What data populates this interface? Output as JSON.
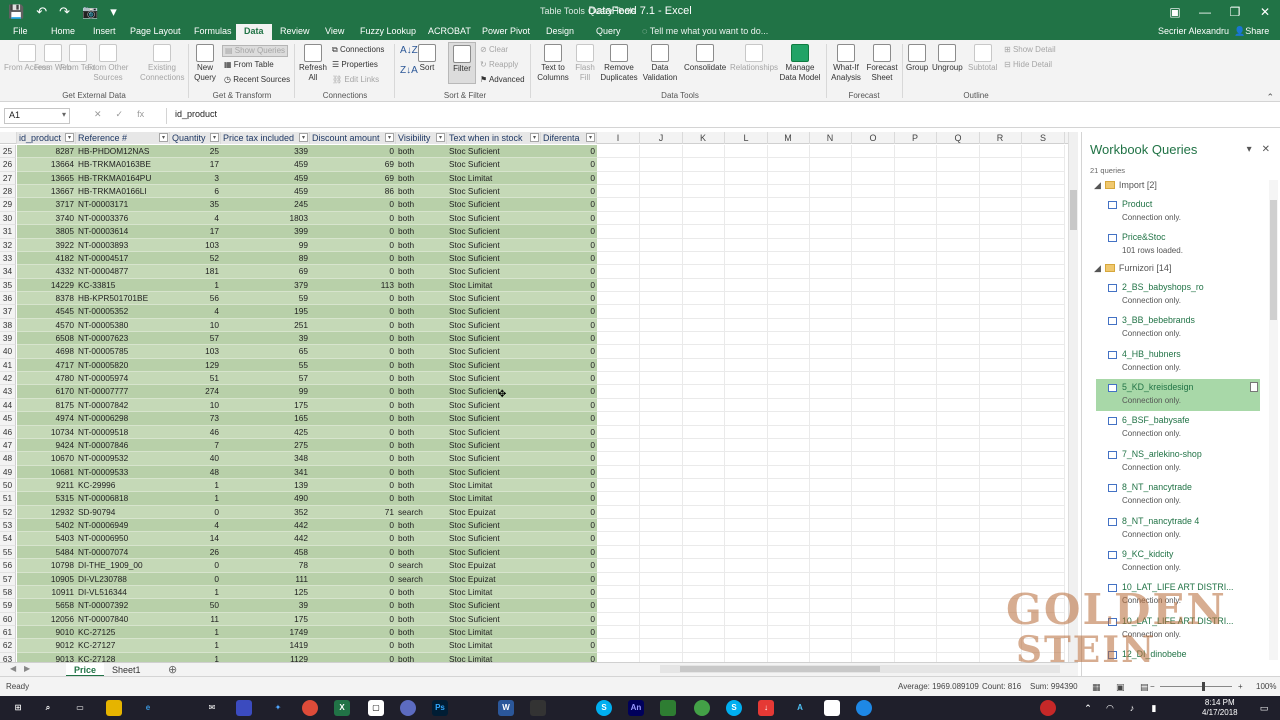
{
  "window": {
    "title": "DataFeed 7.1 - Excel",
    "context_tabs": [
      "Table Tools",
      "Query Tools"
    ],
    "controls": [
      "▣",
      "—",
      "❐",
      "✕"
    ]
  },
  "qat": [
    "💾",
    "↶",
    "↷",
    "📷",
    "▾"
  ],
  "tabs": [
    "File",
    "Home",
    "Insert",
    "Page Layout",
    "Formulas",
    "Data",
    "Review",
    "View",
    "Fuzzy Lookup",
    "ACROBAT",
    "Power Pivot",
    "Design",
    "Query"
  ],
  "active_tab": "Data",
  "tell_me": "Tell me what you want to do...",
  "user": "Secrier Alexandru",
  "share": "Share",
  "ribbon": {
    "get_external": {
      "label": "Get External Data",
      "buttons": [
        "From Access",
        "From Web",
        "From Text",
        "From Other Sources",
        "Existing Connections"
      ]
    },
    "get_transform": {
      "label": "Get & Transform",
      "new_query": "New Query",
      "show_queries": "Show Queries",
      "from_table": "From Table",
      "recent_sources": "Recent Sources"
    },
    "connections": {
      "label": "Connections",
      "refresh": "Refresh All",
      "connections": "Connections",
      "properties": "Properties",
      "edit_links": "Edit Links"
    },
    "sort_filter": {
      "label": "Sort & Filter",
      "sort": "Sort",
      "filter": "Filter",
      "clear": "Clear",
      "reapply": "Reapply",
      "advanced": "Advanced"
    },
    "data_tools": {
      "label": "Data Tools",
      "buttons": [
        "Text to Columns",
        "Flash Fill",
        "Remove Duplicates",
        "Data Validation",
        "Consolidate",
        "Relationships",
        "Manage Data Model"
      ]
    },
    "forecast": {
      "label": "Forecast",
      "buttons": [
        "What-If Analysis",
        "Forecast Sheet"
      ]
    },
    "outline": {
      "label": "Outline",
      "buttons": [
        "Group",
        "Ungroup",
        "Subtotal"
      ],
      "show_detail": "Show Detail",
      "hide_detail": "Hide Detail"
    }
  },
  "formula_bar": {
    "name_box": "A1",
    "formula": "id_product",
    "fx": [
      "✕",
      "✓",
      "fx"
    ]
  },
  "columns": {
    "table": [
      "id_product",
      "Reference #",
      "Quantity",
      "Price tax included",
      "Discount amount",
      "Visibility",
      "Text when in stock",
      "Diferenta"
    ],
    "extra": [
      "I",
      "J",
      "K",
      "L",
      "M",
      "N",
      "O",
      "P",
      "Q",
      "R",
      "S"
    ]
  },
  "rows": [
    {
      "n": "25",
      "id": "8287",
      "ref": "HB-PHDOM12NAS",
      "qty": "25",
      "price": "339",
      "disc": "0",
      "vis": "both",
      "stock": "Stoc Suficient",
      "dif": "0"
    },
    {
      "n": "26",
      "id": "13664",
      "ref": "HB-TRKMA0163BE",
      "qty": "17",
      "price": "459",
      "disc": "69",
      "vis": "both",
      "stock": "Stoc Suficient",
      "dif": "0"
    },
    {
      "n": "27",
      "id": "13665",
      "ref": "HB-TRKMA0164PU",
      "qty": "3",
      "price": "459",
      "disc": "69",
      "vis": "both",
      "stock": "Stoc Limitat",
      "dif": "0"
    },
    {
      "n": "28",
      "id": "13667",
      "ref": "HB-TRKMA0166LI",
      "qty": "6",
      "price": "459",
      "disc": "86",
      "vis": "both",
      "stock": "Stoc Suficient",
      "dif": "0"
    },
    {
      "n": "29",
      "id": "3717",
      "ref": "NT-00003171",
      "qty": "35",
      "price": "245",
      "disc": "0",
      "vis": "both",
      "stock": "Stoc Suficient",
      "dif": "0"
    },
    {
      "n": "30",
      "id": "3740",
      "ref": "NT-00003376",
      "qty": "4",
      "price": "1803",
      "disc": "0",
      "vis": "both",
      "stock": "Stoc Suficient",
      "dif": "0"
    },
    {
      "n": "31",
      "id": "3805",
      "ref": "NT-00003614",
      "qty": "17",
      "price": "399",
      "disc": "0",
      "vis": "both",
      "stock": "Stoc Suficient",
      "dif": "0"
    },
    {
      "n": "32",
      "id": "3922",
      "ref": "NT-00003893",
      "qty": "103",
      "price": "99",
      "disc": "0",
      "vis": "both",
      "stock": "Stoc Suficient",
      "dif": "0"
    },
    {
      "n": "33",
      "id": "4182",
      "ref": "NT-00004517",
      "qty": "52",
      "price": "89",
      "disc": "0",
      "vis": "both",
      "stock": "Stoc Suficient",
      "dif": "0"
    },
    {
      "n": "34",
      "id": "4332",
      "ref": "NT-00004877",
      "qty": "181",
      "price": "69",
      "disc": "0",
      "vis": "both",
      "stock": "Stoc Suficient",
      "dif": "0"
    },
    {
      "n": "35",
      "id": "14229",
      "ref": "KC-33815",
      "qty": "1",
      "price": "379",
      "disc": "113",
      "vis": "both",
      "stock": "Stoc Limitat",
      "dif": "0"
    },
    {
      "n": "36",
      "id": "8378",
      "ref": "HB-KPR501701BE",
      "qty": "56",
      "price": "59",
      "disc": "0",
      "vis": "both",
      "stock": "Stoc Suficient",
      "dif": "0"
    },
    {
      "n": "37",
      "id": "4545",
      "ref": "NT-00005352",
      "qty": "4",
      "price": "195",
      "disc": "0",
      "vis": "both",
      "stock": "Stoc Suficient",
      "dif": "0"
    },
    {
      "n": "38",
      "id": "4570",
      "ref": "NT-00005380",
      "qty": "10",
      "price": "251",
      "disc": "0",
      "vis": "both",
      "stock": "Stoc Suficient",
      "dif": "0"
    },
    {
      "n": "39",
      "id": "6508",
      "ref": "NT-00007623",
      "qty": "57",
      "price": "39",
      "disc": "0",
      "vis": "both",
      "stock": "Stoc Suficient",
      "dif": "0"
    },
    {
      "n": "40",
      "id": "4698",
      "ref": "NT-00005785",
      "qty": "103",
      "price": "65",
      "disc": "0",
      "vis": "both",
      "stock": "Stoc Suficient",
      "dif": "0"
    },
    {
      "n": "41",
      "id": "4717",
      "ref": "NT-00005820",
      "qty": "129",
      "price": "55",
      "disc": "0",
      "vis": "both",
      "stock": "Stoc Suficient",
      "dif": "0"
    },
    {
      "n": "42",
      "id": "4780",
      "ref": "NT-00005974",
      "qty": "51",
      "price": "57",
      "disc": "0",
      "vis": "both",
      "stock": "Stoc Suficient",
      "dif": "0"
    },
    {
      "n": "43",
      "id": "6170",
      "ref": "NT-00007777",
      "qty": "274",
      "price": "99",
      "disc": "0",
      "vis": "both",
      "stock": "Stoc Suficient",
      "dif": "0"
    },
    {
      "n": "44",
      "id": "8175",
      "ref": "NT-00007842",
      "qty": "10",
      "price": "175",
      "disc": "0",
      "vis": "both",
      "stock": "Stoc Suficient",
      "dif": "0"
    },
    {
      "n": "45",
      "id": "4974",
      "ref": "NT-00006298",
      "qty": "73",
      "price": "165",
      "disc": "0",
      "vis": "both",
      "stock": "Stoc Suficient",
      "dif": "0"
    },
    {
      "n": "46",
      "id": "10734",
      "ref": "NT-00009518",
      "qty": "46",
      "price": "425",
      "disc": "0",
      "vis": "both",
      "stock": "Stoc Suficient",
      "dif": "0"
    },
    {
      "n": "47",
      "id": "9424",
      "ref": "NT-00007846",
      "qty": "7",
      "price": "275",
      "disc": "0",
      "vis": "both",
      "stock": "Stoc Suficient",
      "dif": "0"
    },
    {
      "n": "48",
      "id": "10670",
      "ref": "NT-00009532",
      "qty": "40",
      "price": "348",
      "disc": "0",
      "vis": "both",
      "stock": "Stoc Suficient",
      "dif": "0"
    },
    {
      "n": "49",
      "id": "10681",
      "ref": "NT-00009533",
      "qty": "48",
      "price": "341",
      "disc": "0",
      "vis": "both",
      "stock": "Stoc Suficient",
      "dif": "0"
    },
    {
      "n": "50",
      "id": "9211",
      "ref": "KC-29996",
      "qty": "1",
      "price": "139",
      "disc": "0",
      "vis": "both",
      "stock": "Stoc Limitat",
      "dif": "0"
    },
    {
      "n": "51",
      "id": "5315",
      "ref": "NT-00006818",
      "qty": "1",
      "price": "490",
      "disc": "0",
      "vis": "both",
      "stock": "Stoc Limitat",
      "dif": "0"
    },
    {
      "n": "52",
      "id": "12932",
      "ref": "SD-90794",
      "qty": "0",
      "price": "352",
      "disc": "71",
      "vis": "search",
      "stock": "Stoc Epuizat",
      "dif": "0"
    },
    {
      "n": "53",
      "id": "5402",
      "ref": "NT-00006949",
      "qty": "4",
      "price": "442",
      "disc": "0",
      "vis": "both",
      "stock": "Stoc Suficient",
      "dif": "0"
    },
    {
      "n": "54",
      "id": "5403",
      "ref": "NT-00006950",
      "qty": "14",
      "price": "442",
      "disc": "0",
      "vis": "both",
      "stock": "Stoc Suficient",
      "dif": "0"
    },
    {
      "n": "55",
      "id": "5484",
      "ref": "NT-00007074",
      "qty": "26",
      "price": "458",
      "disc": "0",
      "vis": "both",
      "stock": "Stoc Suficient",
      "dif": "0"
    },
    {
      "n": "56",
      "id": "10798",
      "ref": "DI-THE_1909_00",
      "qty": "0",
      "price": "78",
      "disc": "0",
      "vis": "search",
      "stock": "Stoc Epuizat",
      "dif": "0"
    },
    {
      "n": "57",
      "id": "10905",
      "ref": "DI-VL230788",
      "qty": "0",
      "price": "111",
      "disc": "0",
      "vis": "search",
      "stock": "Stoc Epuizat",
      "dif": "0"
    },
    {
      "n": "58",
      "id": "10911",
      "ref": "DI-VL516344",
      "qty": "1",
      "price": "125",
      "disc": "0",
      "vis": "both",
      "stock": "Stoc Limitat",
      "dif": "0"
    },
    {
      "n": "59",
      "id": "5658",
      "ref": "NT-00007392",
      "qty": "50",
      "price": "39",
      "disc": "0",
      "vis": "both",
      "stock": "Stoc Suficient",
      "dif": "0"
    },
    {
      "n": "60",
      "id": "12056",
      "ref": "NT-00007840",
      "qty": "11",
      "price": "175",
      "disc": "0",
      "vis": "both",
      "stock": "Stoc Suficient",
      "dif": "0"
    },
    {
      "n": "61",
      "id": "9010",
      "ref": "KC-27125",
      "qty": "1",
      "price": "1749",
      "disc": "0",
      "vis": "both",
      "stock": "Stoc Limitat",
      "dif": "0"
    },
    {
      "n": "62",
      "id": "9012",
      "ref": "KC-27127",
      "qty": "1",
      "price": "1419",
      "disc": "0",
      "vis": "both",
      "stock": "Stoc Limitat",
      "dif": "0"
    },
    {
      "n": "63",
      "id": "9013",
      "ref": "KC-27128",
      "qty": "1",
      "price": "1129",
      "disc": "0",
      "vis": "both",
      "stock": "Stoc Limitat",
      "dif": "0"
    }
  ],
  "sheets": [
    "Price",
    "Sheet1"
  ],
  "active_sheet": "Price",
  "add_sheet": "⊕",
  "panel": {
    "title": "Workbook Queries",
    "count": "21 queries",
    "groups": [
      {
        "label": "Import [2]",
        "items": [
          {
            "name": "Product",
            "status": "Connection only."
          },
          {
            "name": "Price&Stoc",
            "status": "101 rows loaded."
          }
        ]
      },
      {
        "label": "Furnizori [14]",
        "items": [
          {
            "name": "2_BS_babyshops_ro",
            "status": "Connection only."
          },
          {
            "name": "3_BB_bebebrands",
            "status": "Connection only."
          },
          {
            "name": "4_HB_hubners",
            "status": "Connection only."
          },
          {
            "name": "5_KD_kreisdesign",
            "status": "Connection only.",
            "selected": true
          },
          {
            "name": "6_BSF_babysafe",
            "status": "Connection only."
          },
          {
            "name": "7_NS_arlekino-shop",
            "status": "Connection only."
          },
          {
            "name": "8_NT_nancytrade",
            "status": "Connection only."
          },
          {
            "name": "8_NT_nancytrade 4",
            "status": "Connection only."
          },
          {
            "name": "9_KC_kidcity",
            "status": "Connection only."
          },
          {
            "name": "10_LAT_LIFE ART DISTRI...",
            "status": "Connection only."
          },
          {
            "name": "10_LAT_LIFE ART DISTRI...",
            "status": "Connection only."
          },
          {
            "name": "12_DI_dinobebe",
            "status": ""
          }
        ]
      }
    ]
  },
  "status": {
    "ready": "Ready",
    "average": "Average: 1969.089109",
    "count": "Count: 816",
    "sum": "Sum: 994390",
    "zoom": "100%"
  },
  "taskbar": {
    "date": "4/17/2018",
    "time": "8:14 PM"
  },
  "watermark": [
    "GOLDEN",
    "STEIN"
  ],
  "colors": {
    "excel_green": "#217346",
    "table_band": "#b8d0a9",
    "selected_query": "#a8d8a8"
  }
}
